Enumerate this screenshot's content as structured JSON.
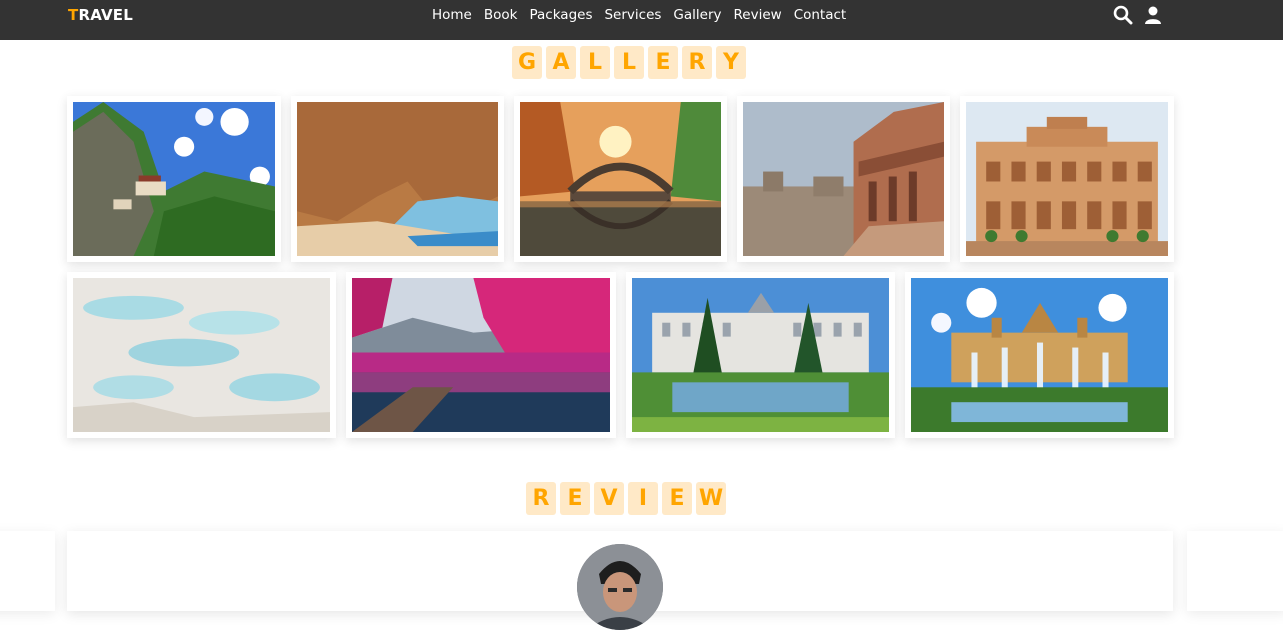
{
  "header": {
    "logo_first": "T",
    "logo_rest": "RAVEL",
    "nav": [
      "Home",
      "Book",
      "Packages",
      "Services",
      "Gallery",
      "Review",
      "Contact"
    ],
    "icons": [
      "search-icon",
      "user-icon"
    ]
  },
  "gallery": {
    "heading_letters": [
      "G",
      "A",
      "L",
      "L",
      "E",
      "R",
      "Y"
    ],
    "images": [
      "mountain-monastery-photo",
      "sea-cave-beach-photo",
      "stone-bridge-autumn-photo",
      "old-fort-city-photo",
      "sandstone-palace-photo",
      "white-travertine-terraces-photo",
      "pink-blossom-lake-photo",
      "royal-palace-garden-photo",
      "palace-fountains-photo"
    ]
  },
  "review": {
    "heading_letters": [
      "R",
      "E",
      "V",
      "I",
      "E",
      "W"
    ]
  },
  "colors": {
    "accent": "#ffa500",
    "accent_bg": "#ffe9c7",
    "header_bg": "#333333"
  }
}
